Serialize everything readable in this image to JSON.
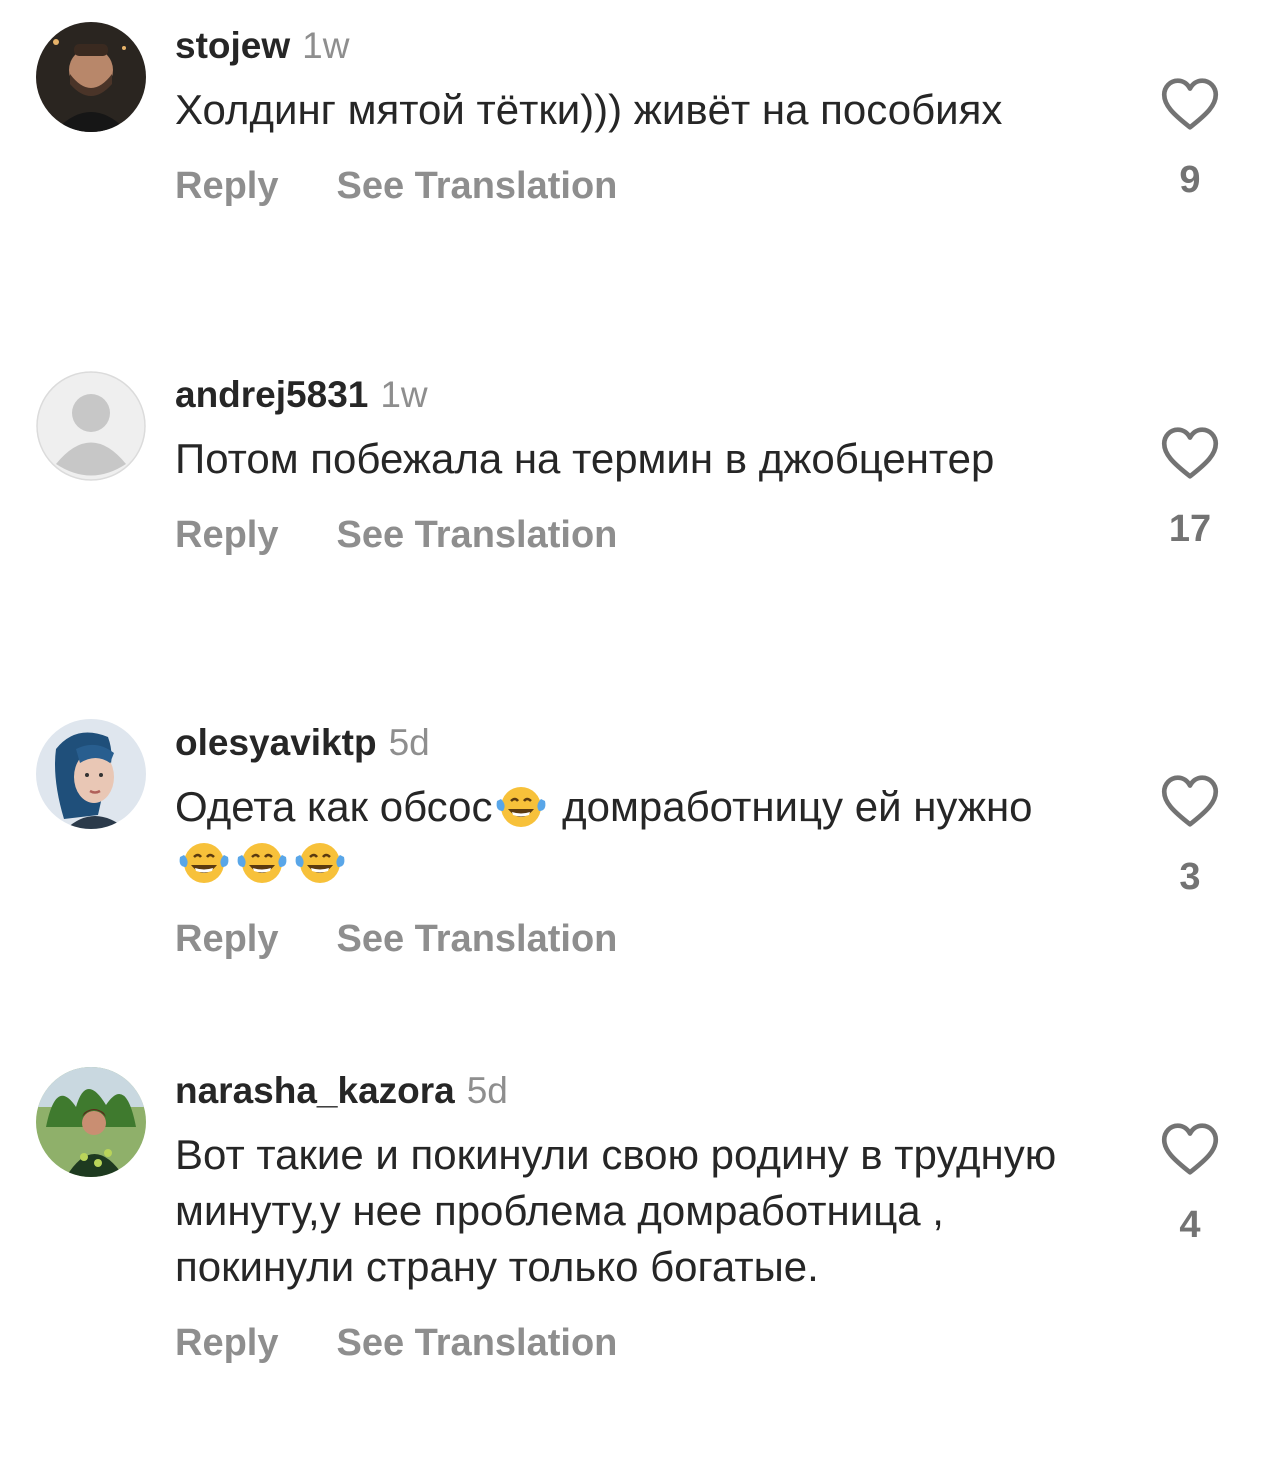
{
  "comments": [
    {
      "username": "stojew",
      "time": "1w",
      "text": "Холдинг мятой тётки))) живёт на пособиях",
      "reply_label": "Reply",
      "translate_label": "See Translation",
      "likes": "9",
      "avatar_icon": "user-photo"
    },
    {
      "username": "andrej5831",
      "time": "1w",
      "text": "Потом побежала на термин в джобцентер",
      "reply_label": "Reply",
      "translate_label": "See Translation",
      "likes": "17",
      "avatar_icon": "default-avatar-icon"
    },
    {
      "username": "olesyaviktp",
      "time": "5d",
      "text_part1": "Одета как обсос",
      "emoji": "😂",
      "text_part2": " домработницу ей нужно",
      "reply_label": "Reply",
      "translate_label": "See Translation",
      "likes": "3",
      "avatar_icon": "user-photo"
    },
    {
      "username": "narasha_kazora",
      "time": "5d",
      "text": "Вот такие и покинули свою родину в трудную минуту,у нее проблема домработница , покинули страну только богатые.",
      "reply_label": "Reply",
      "translate_label": "See Translation",
      "likes": "4",
      "avatar_icon": "user-photo"
    }
  ],
  "icons": {
    "like": "heart-outline-icon"
  },
  "colors": {
    "text": "#262626",
    "muted": "#8e8e8e",
    "like_count": "#737373"
  }
}
